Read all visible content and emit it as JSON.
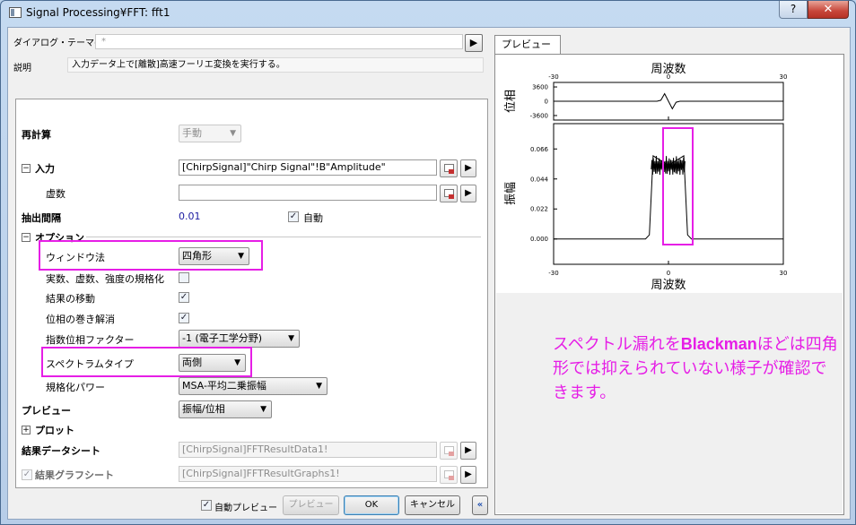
{
  "window": {
    "title": "Signal Processing¥FFT: fft1",
    "help_label": "?",
    "close_label": "✕"
  },
  "header": {
    "theme_label": "ダイアログ・テーマ(H)",
    "theme_value": "*",
    "desc_label": "説明",
    "desc_value": "入力データ上で[離散]高速フーリエ変換を実行する。"
  },
  "settings": {
    "recalc_label": "再計算",
    "recalc_value": "手動",
    "input_label": "入力",
    "input_value": "[ChirpSignal]\"Chirp Signal\"!B\"Amplitude\"",
    "imag_label": "虚数",
    "imag_value": "",
    "interval_label": "抽出間隔",
    "interval_value": "0.01",
    "auto_label": "自動",
    "options_label": "オプション",
    "window_label": "ウィンドウ法",
    "window_value": "四角形",
    "normalize_label": "実数、虚数、強度の規格化",
    "shift_label": "結果の移動",
    "unwrap_label": "位相の巻き解消",
    "exp_label": "指数位相ファクター",
    "exp_value": "-1 (電子工学分野)",
    "spectrum_label": "スペクトラムタイプ",
    "spectrum_value": "両側",
    "power_label": "規格化パワー",
    "power_value": "MSA-平均二乗振幅",
    "preview_label": "プレビュー",
    "preview_value": "振幅/位相",
    "plot_label": "プロット",
    "result_sheet_label": "結果データシート",
    "result_sheet_value": "[ChirpSignal]FFTResultData1!",
    "result_graph_label": "結果グラフシート",
    "result_graph_value": "[ChirpSignal]FFTResultGraphs1!"
  },
  "footer": {
    "auto_preview_label": "自動プレビュー",
    "preview_button": "プレビュー",
    "ok_button": "OK",
    "cancel_button": "キャンセル",
    "collapse_label": "«"
  },
  "preview": {
    "tab_label": "プレビュー",
    "note": "スペクトル漏れをBlackmanほどは四角形では抑えられていない様子が確認できます。"
  },
  "chart_data": [
    {
      "type": "line",
      "title": "",
      "xlabel": "周波数",
      "ylabel": "位相",
      "xticks": [
        "-30",
        "0",
        "30"
      ],
      "yticks": [
        "3600",
        "0",
        "-3600"
      ],
      "xlim": [
        -30,
        30
      ],
      "ylim": [
        -3600,
        3600
      ],
      "series": [
        {
          "x": [
            -30,
            -3,
            -2,
            -1,
            0,
            1,
            2,
            3,
            30
          ],
          "values": [
            0,
            0,
            250,
            1900,
            0,
            -1900,
            -250,
            0,
            0
          ]
        }
      ]
    },
    {
      "type": "line",
      "title": "",
      "xlabel": "周波数",
      "ylabel": "振幅",
      "xticks": [
        "-30",
        "0",
        "30"
      ],
      "yticks": [
        "0.066",
        "0.044",
        "0.022",
        "0.000"
      ],
      "xlim": [
        -30,
        30
      ],
      "ylim": [
        0,
        0.066
      ],
      "series": [
        {
          "x": [
            -30,
            -6,
            -5,
            -4,
            0,
            4,
            5,
            6,
            30
          ],
          "values": [
            0,
            0,
            0.003,
            0.061,
            0.054,
            0.061,
            0.003,
            0,
            0
          ]
        }
      ]
    }
  ],
  "colors": {
    "highlight": "#e61ee6",
    "link_value": "#1a1aa0"
  }
}
